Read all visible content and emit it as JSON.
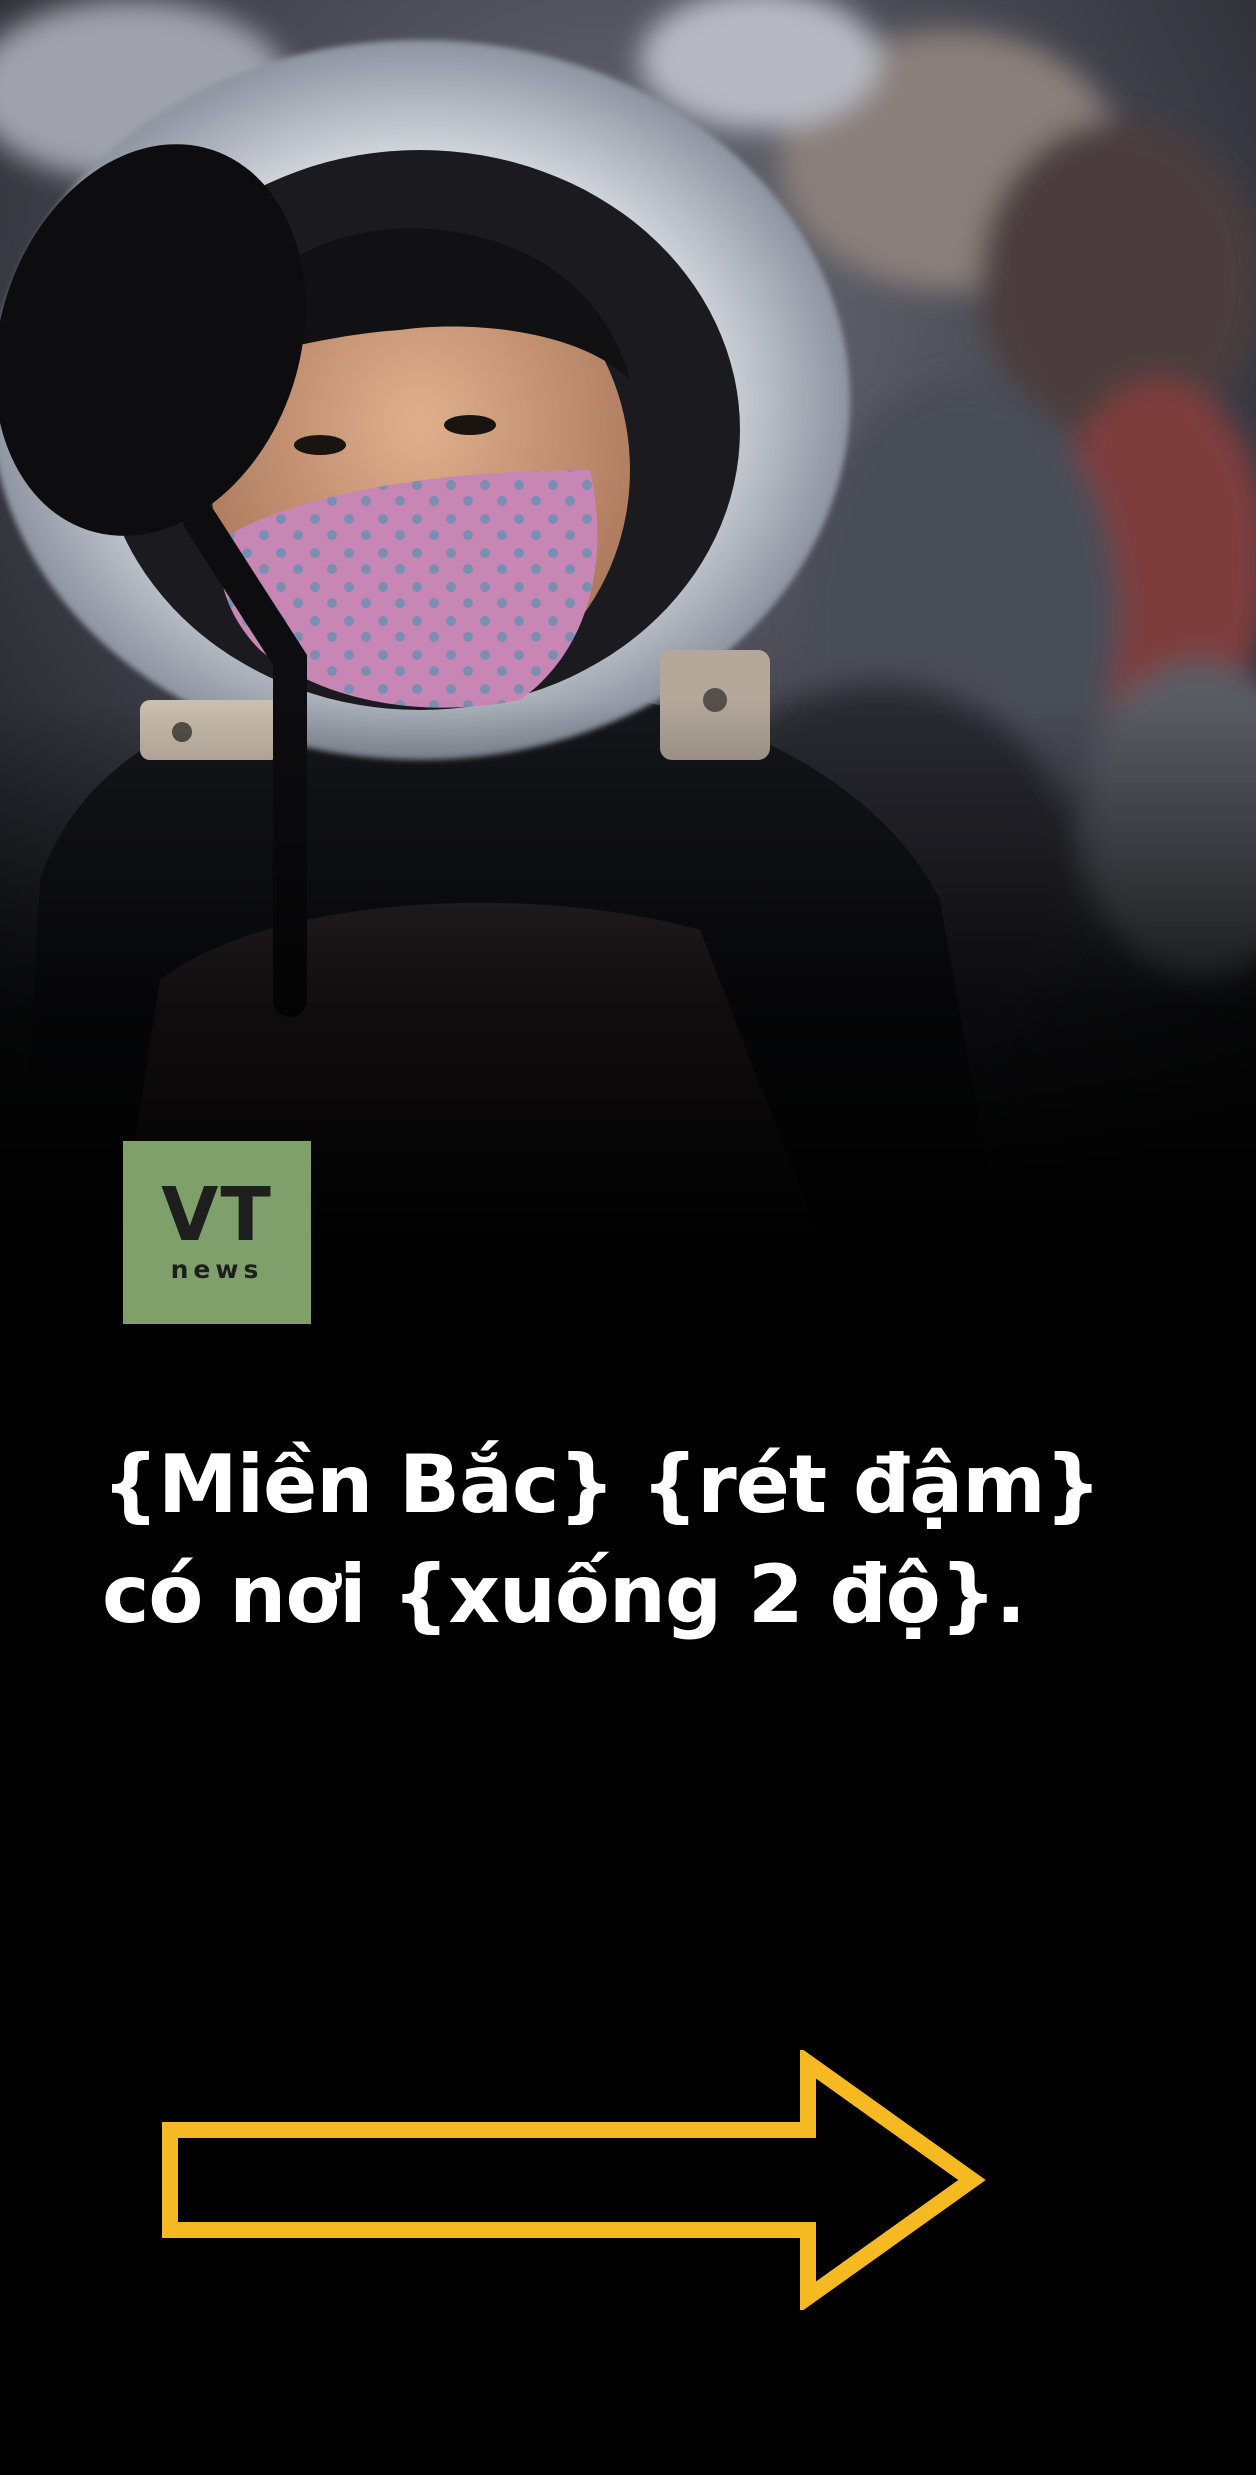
{
  "brand": {
    "logo_main": "VT",
    "logo_sub": "news",
    "logo_bg": "#7f9f6b"
  },
  "headline": {
    "line1": "{Miền Bắc} {rét đậm}",
    "line2": "có nơi {xuống 2 độ}."
  },
  "navigation": {
    "next_icon": "right-arrow-icon",
    "arrow_color": "#f5b921"
  }
}
